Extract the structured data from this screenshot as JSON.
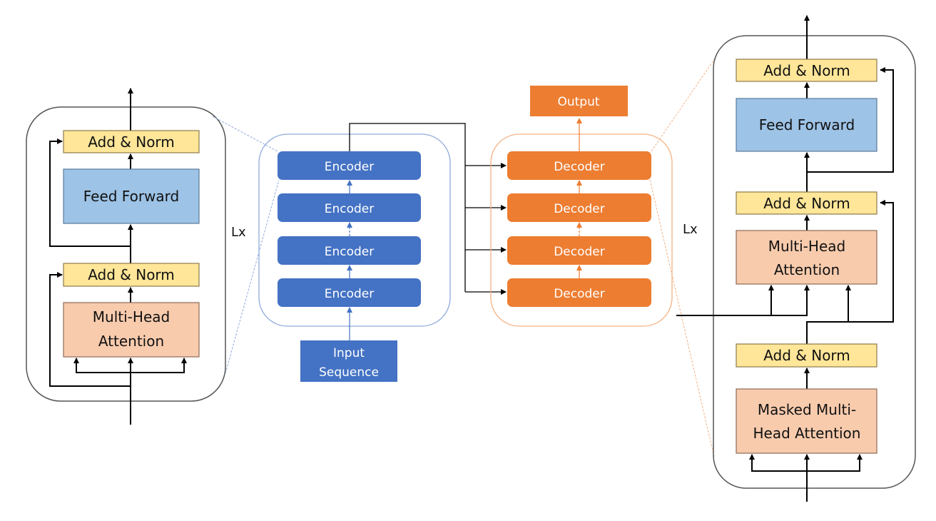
{
  "colors": {
    "add_norm_fill": "#FFE699",
    "add_norm_stroke": "#8C7A4A",
    "feed_forward_fill": "#9DC3E6",
    "feed_forward_stroke": "#5B7A99",
    "attention_fill": "#F8CBAD",
    "attention_stroke": "#8C6A58",
    "encoder_fill": "#4472C4",
    "encoder_frame": "#8FAADC",
    "decoder_fill": "#ED7D31",
    "decoder_frame": "#F4B183",
    "line": "#000000",
    "frame": "#555555"
  },
  "encoder_detail": {
    "add_norm_top": "Add & Norm",
    "feed_forward": "Feed Forward",
    "add_norm_bottom": "Add & Norm",
    "attention_line1": "Multi-Head",
    "attention_line2": "Attention",
    "repeat_label": "Lx"
  },
  "encoder_stack": {
    "blocks": [
      "Encoder",
      "Encoder",
      "Encoder",
      "Encoder"
    ],
    "input_line1": "Input",
    "input_line2": "Sequence"
  },
  "decoder_stack": {
    "blocks": [
      "Decoder",
      "Decoder",
      "Decoder",
      "Decoder"
    ],
    "output": "Output"
  },
  "decoder_detail": {
    "add_norm_top": "Add & Norm",
    "feed_forward": "Feed Forward",
    "add_norm_middle": "Add & Norm",
    "attention_line1": "Multi-Head",
    "attention_line2": "Attention",
    "add_norm_bottom": "Add & Norm",
    "masked_line1": "Masked Multi-",
    "masked_line2": "Head Attention",
    "repeat_label": "Lx"
  }
}
